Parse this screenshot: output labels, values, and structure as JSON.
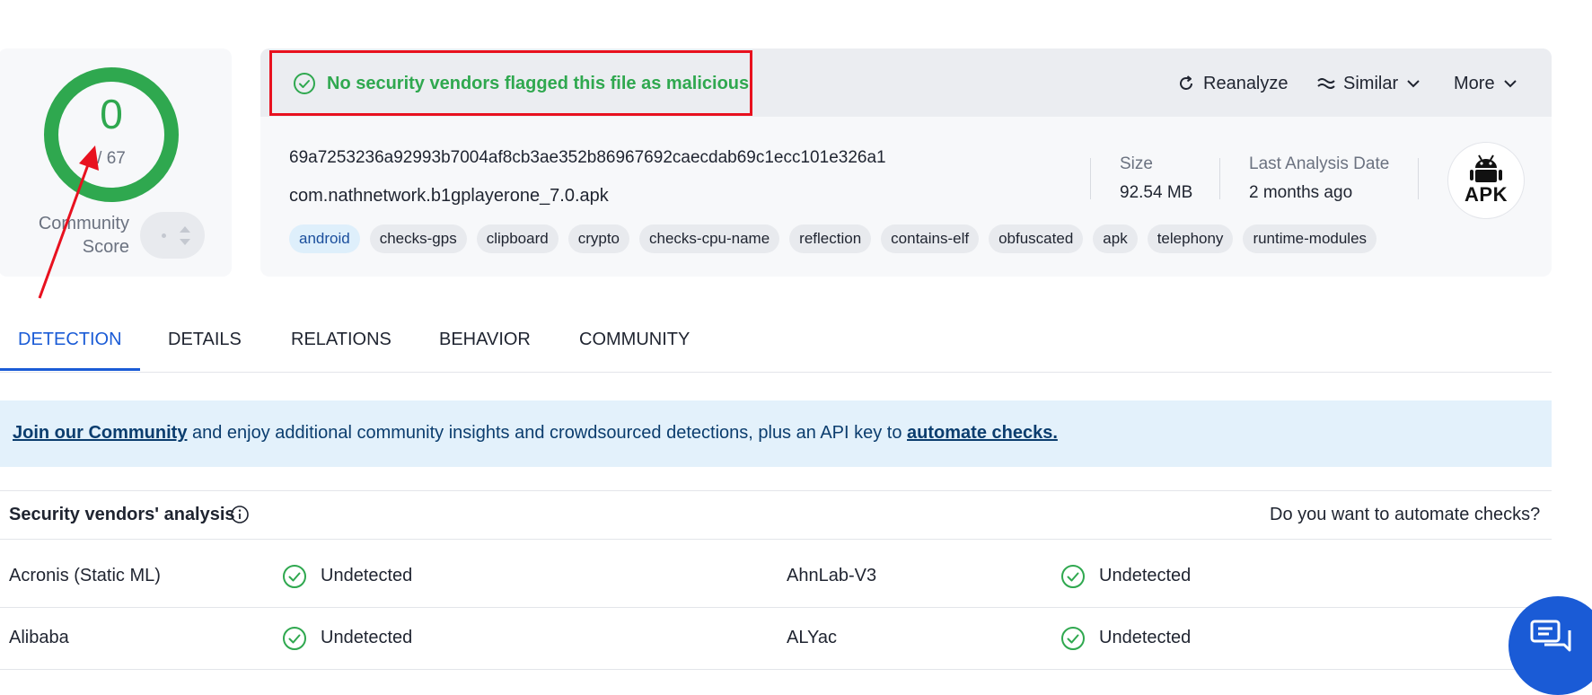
{
  "score": {
    "value": "0",
    "total": "/ 67",
    "community_label_1": "Community",
    "community_label_2": "Score"
  },
  "banner_flag": "No security vendors flagged this file as malicious",
  "actions": {
    "reanalyze": "Reanalyze",
    "similar": "Similar",
    "more": "More"
  },
  "file": {
    "hash": "69a7253236a92993b7004af8cb3ae352b86967692caecdab69c1ecc101e326a1",
    "name": "com.nathnetwork.b1gplayerone_7.0.apk",
    "size_label": "Size",
    "size_value": "92.54 MB",
    "date_label": "Last Analysis Date",
    "date_value": "2 months ago",
    "type_badge": "APK"
  },
  "tags": [
    "android",
    "checks-gps",
    "clipboard",
    "crypto",
    "checks-cpu-name",
    "reflection",
    "contains-elf",
    "obfuscated",
    "apk",
    "telephony",
    "runtime-modules"
  ],
  "tabs": [
    "DETECTION",
    "DETAILS",
    "RELATIONS",
    "BEHAVIOR",
    "COMMUNITY"
  ],
  "community_banner": {
    "link1": "Join our Community",
    "middle": " and enjoy additional community insights and crowdsourced detections, plus an API key to ",
    "link2": "automate checks."
  },
  "vendors": {
    "title": "Security vendors' analysis",
    "automate_prompt": "Do you want to automate checks?",
    "rows": [
      {
        "left_name": "Acronis (Static ML)",
        "left_status": "Undetected",
        "right_name": "AhnLab-V3",
        "right_status": "Undetected"
      },
      {
        "left_name": "Alibaba",
        "left_status": "Undetected",
        "right_name": "ALYac",
        "right_status": "Undetected"
      }
    ]
  },
  "colors": {
    "clean": "#2fa84f",
    "accent": "#1a5bd6",
    "highlight_box": "#e8111f",
    "annotation_arrow": "#e8111f"
  }
}
